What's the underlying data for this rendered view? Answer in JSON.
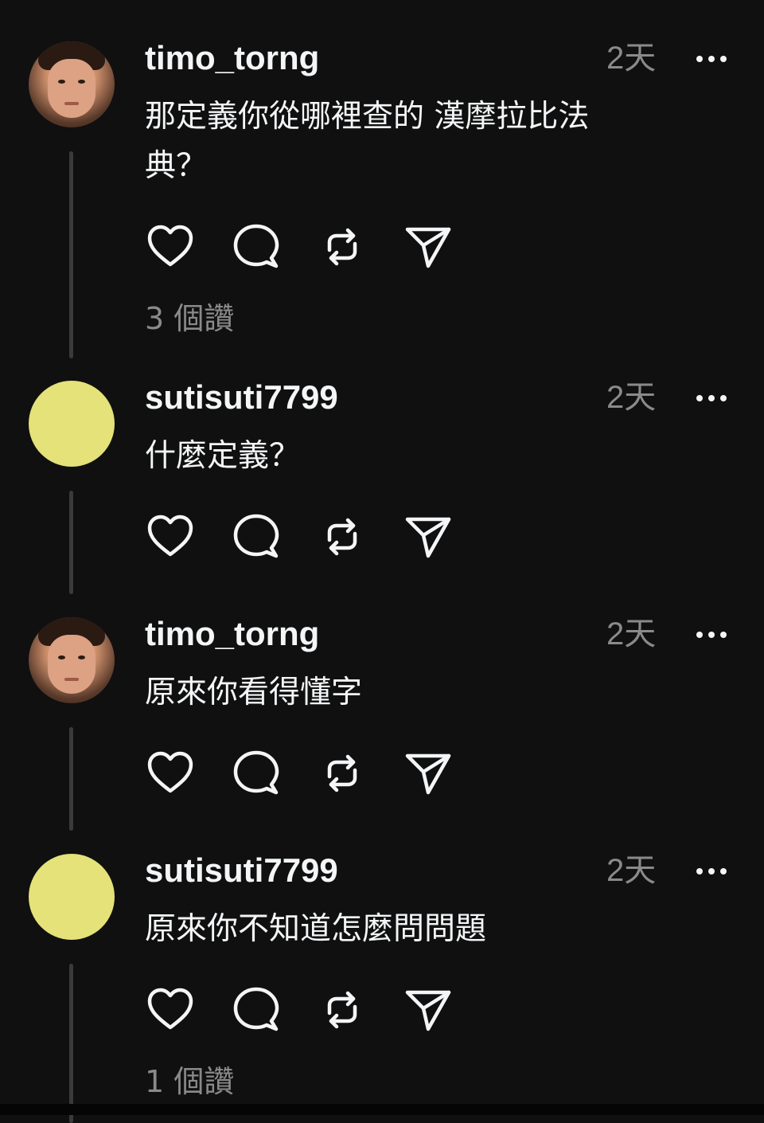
{
  "comments": [
    {
      "username": "timo_torng",
      "time": "2天",
      "text_line1": "那定義你從哪裡查的 漢摩拉比法",
      "text_line2": "典？",
      "likes": "3 個讚",
      "avatar": "profile-photo"
    },
    {
      "username": "sutisuti7799",
      "time": "2天",
      "text_line1": "什麼定義？",
      "avatar": "yellow-circle"
    },
    {
      "username": "timo_torng",
      "time": "2天",
      "text_line1": "原來你看得懂字",
      "avatar": "profile-photo"
    },
    {
      "username": "sutisuti7799",
      "time": "2天",
      "text_line1": "原來你不知道怎麼問問題",
      "likes": "1 個讚",
      "avatar": "yellow-circle"
    }
  ],
  "icons": {
    "like": "heart-icon",
    "reply": "comment-bubble-icon",
    "repost": "repost-icon",
    "share": "send-icon",
    "more": "more-dots-icon"
  },
  "colors": {
    "background": "#101010",
    "text": "#f3f5f7",
    "muted": "#8a8a8a",
    "yellow_avatar": "#e4e278"
  }
}
